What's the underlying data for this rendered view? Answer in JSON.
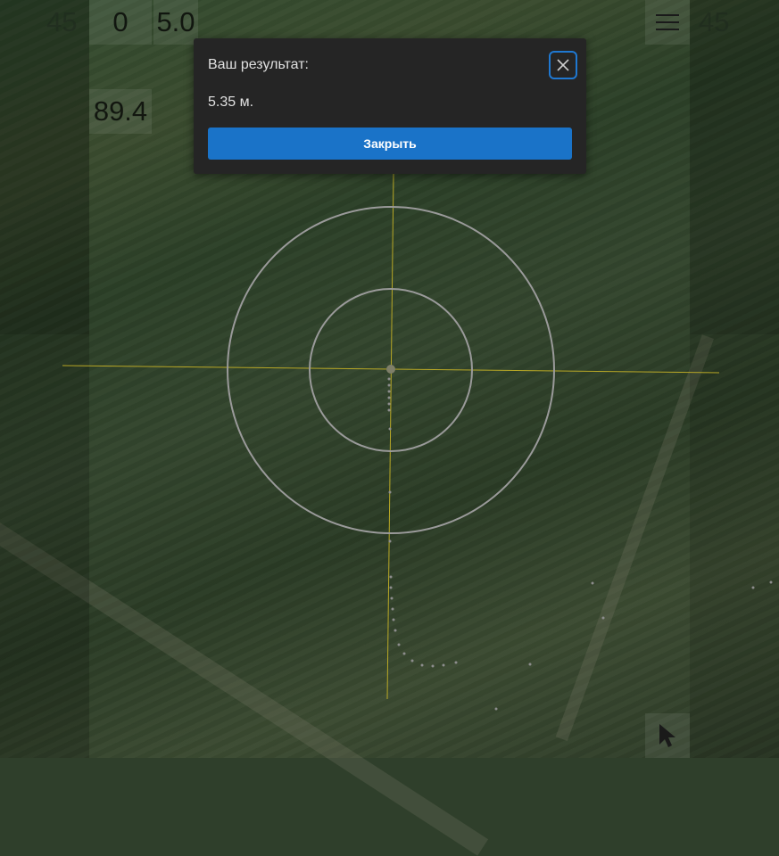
{
  "hud": {
    "left_ghost": "45",
    "right_ghost": "45",
    "counter": "0",
    "distance": "5.0",
    "angle": "89.4"
  },
  "icons": {
    "menu": "hamburger-menu-icon",
    "pointer": "cursor-arrow-icon",
    "close": "close-x-icon"
  },
  "dialog": {
    "title": "Ваш результат:",
    "result": "5.35 м.",
    "close_button": "Закрыть"
  },
  "colors": {
    "crosshair": "#b9a826",
    "rings": "#9a9a9a",
    "button": "#1a73c8",
    "dialog_bg": "#252525",
    "focus_ring": "#1f78d1"
  }
}
